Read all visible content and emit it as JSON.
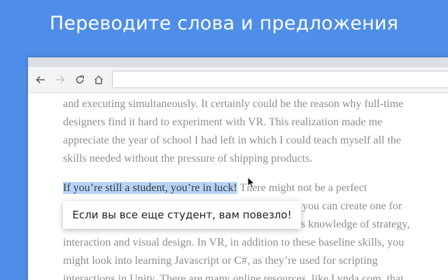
{
  "headline": "Переводите слова и предложения",
  "toolbar": {
    "back_icon": "arrow-left-icon",
    "forward_icon": "arrow-right-icon",
    "reload_icon": "reload-icon",
    "home_icon": "home-icon",
    "address_value": ""
  },
  "article": {
    "paragraph1_lines": [
      "and executing simultaneously. It certainly could be the reason why full-time",
      "designers find it hard to experiment with VR. This realization made me",
      "appreciate the year of school I had left in which I could teach myself all the",
      "skills needed without the pressure of shipping products."
    ],
    "highlighted": "If you’re still a student, you’re in luck!",
    "line1_rest": " There might not be a perfect",
    "line2_rest": "you can create one for",
    "line3_rest": "s knowledge of strategy,",
    "line4": "interaction and visual design. In VR, in addition to these baseline skills, you",
    "line5": "might look into learning Javascript or C#, as they’re used for scripting",
    "line6": "interactions in Unity. There are many online resources, like Lynda.com, that"
  },
  "popup": {
    "translation": "Если вы все еще студент, вам повезло!"
  },
  "colors": {
    "background": "#4f8ee8",
    "highlight": "#b6d3f7"
  }
}
